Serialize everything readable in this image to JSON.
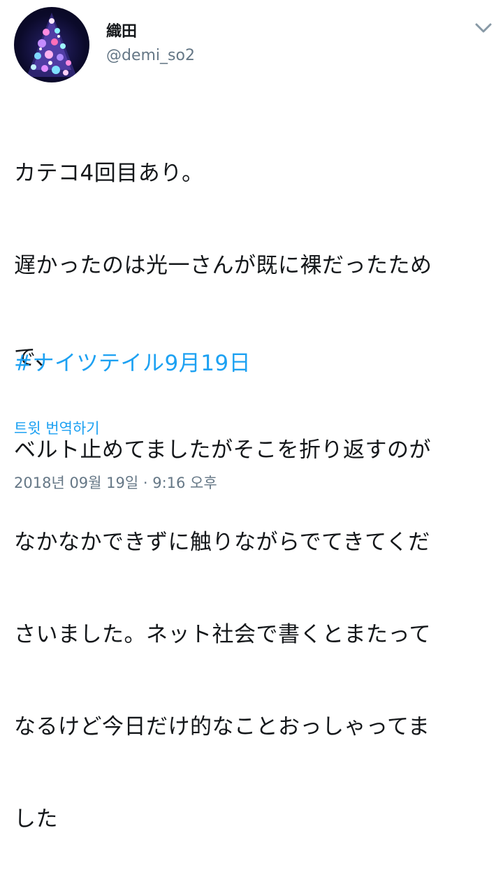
{
  "author": {
    "display_name": "織田",
    "handle": "@demi_so2"
  },
  "tweet": {
    "body_lines": [
      "カテコ4回目あり。",
      "遅かったのは光一さんが既に裸だったため",
      "で、",
      "ベルト止めてましたがそこを折り返すのが",
      "なかなかできずに触りながらでてきてくだ",
      "さいました。ネット社会で書くとまたって",
      "なるけど今日だけ的なことおっしゃってま",
      "した"
    ],
    "hashtag": "#ナイツテイル9月19日",
    "translate_label": "트윗 번역하기",
    "timestamp": "2018년 09월 19일 · 9:16 오후"
  },
  "icons": {
    "menu": "chevron-down-icon",
    "avatar": "avatar"
  },
  "colors": {
    "link": "#1da1f2",
    "secondary": "#657786",
    "text": "#14171a"
  }
}
